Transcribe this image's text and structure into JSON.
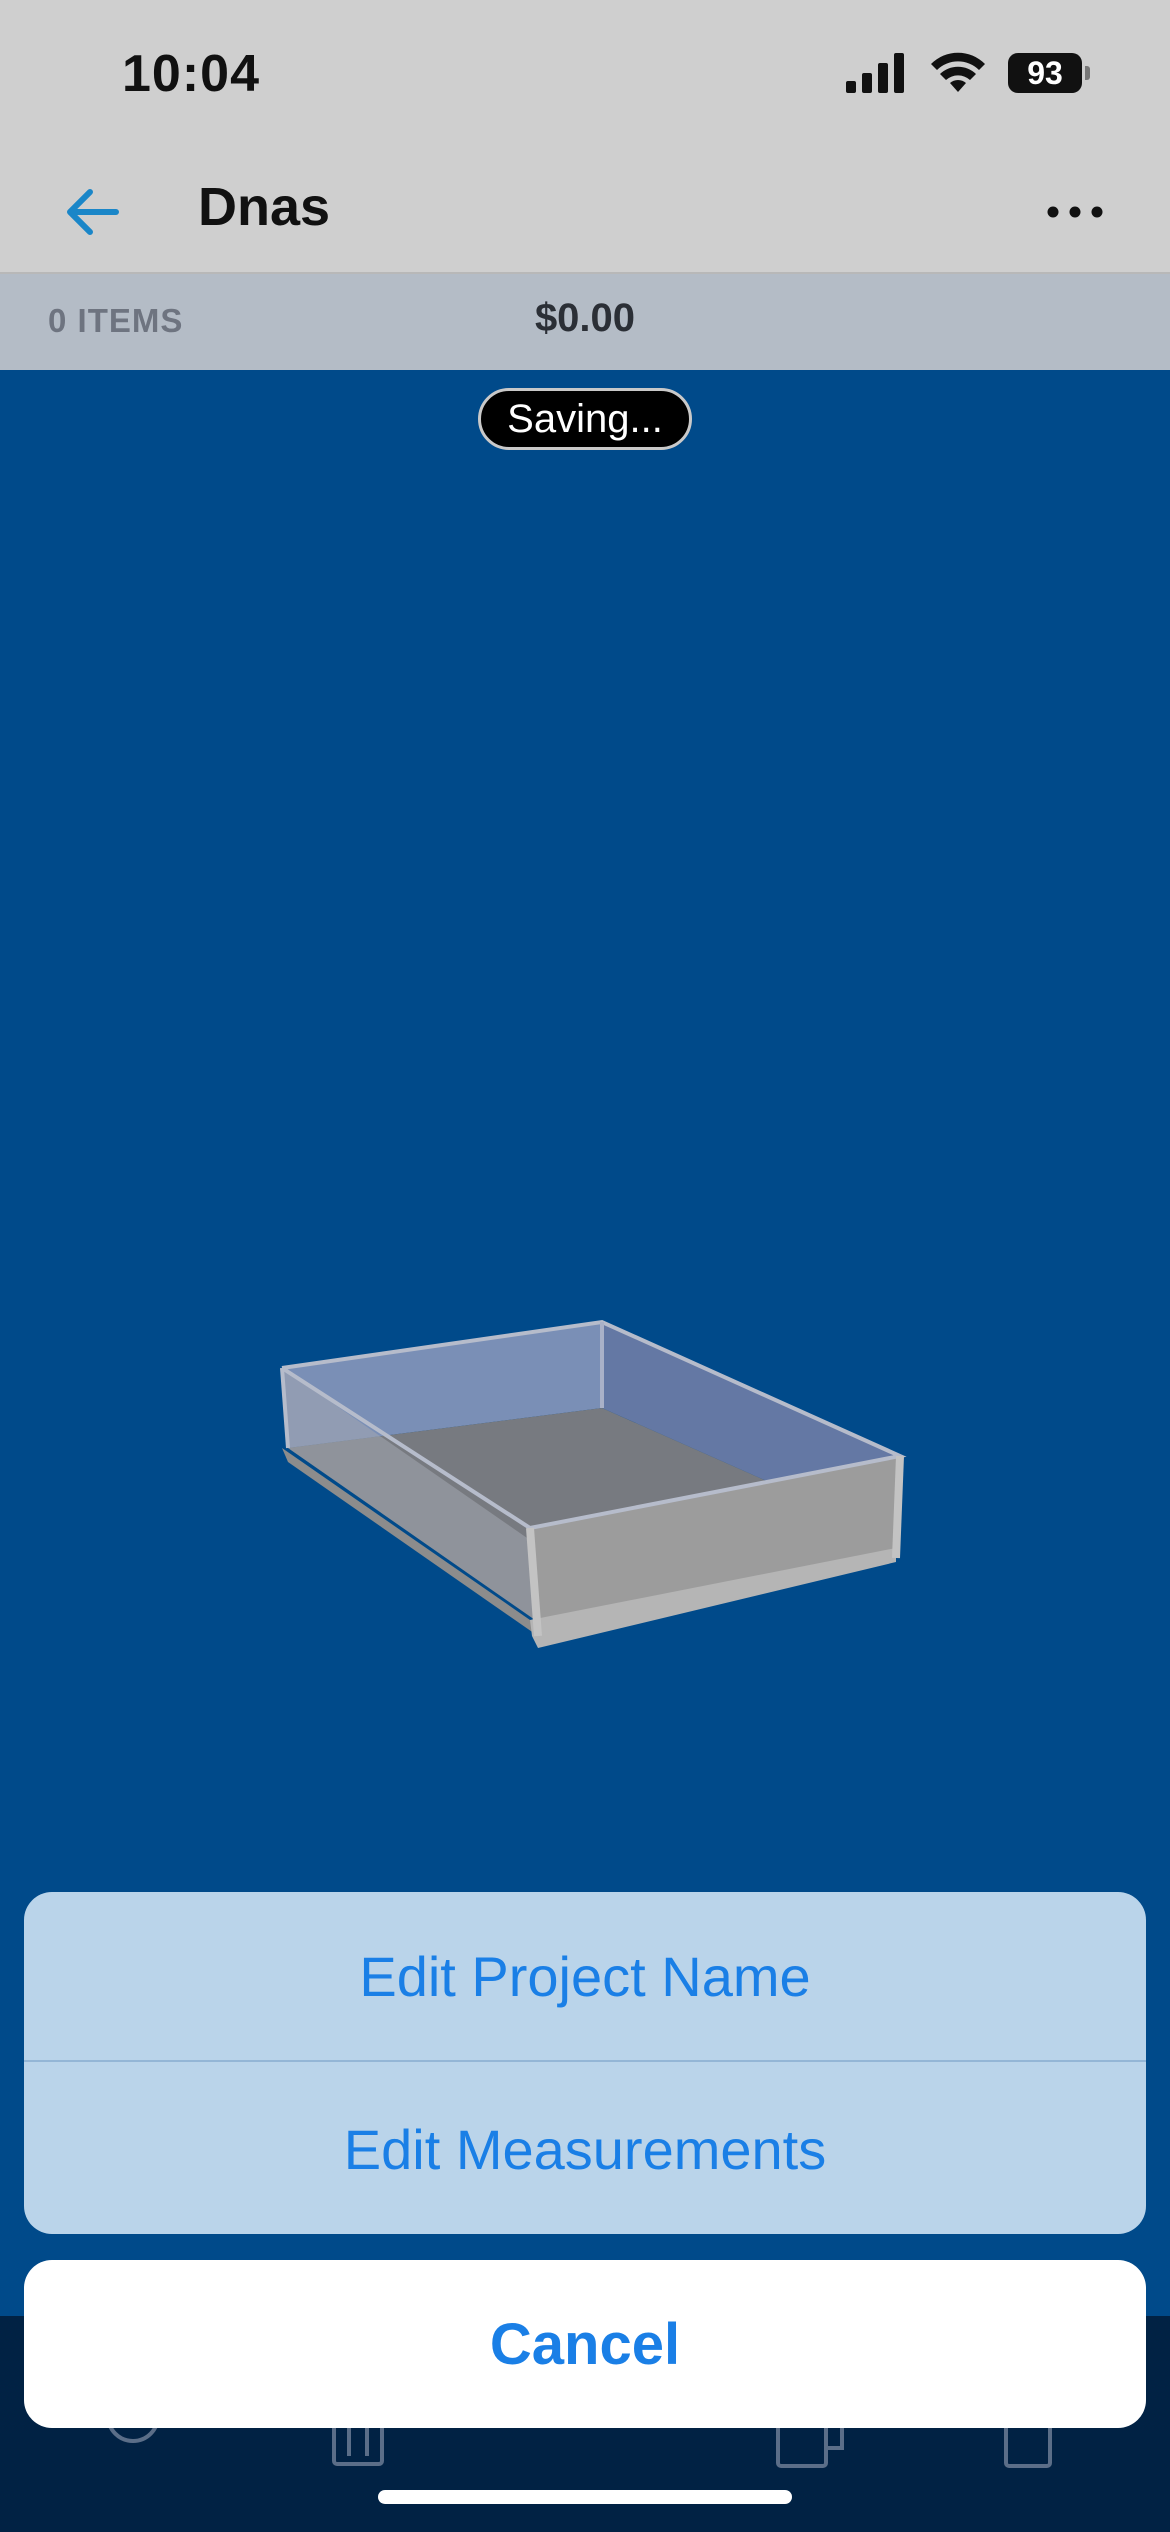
{
  "status_bar": {
    "time": "10:04",
    "battery_level": "93",
    "icons": [
      "cellular-signal-icon",
      "wifi-icon",
      "battery-icon"
    ]
  },
  "nav": {
    "title": "Dnas",
    "back_icon": "arrow-left-icon",
    "more_icon": "ellipsis-icon"
  },
  "summary": {
    "items_count": "0 ITEMS",
    "total": "$0.00"
  },
  "viewport": {
    "status": "Saving..."
  },
  "action_sheet": {
    "options": [
      {
        "label": "Edit Project Name"
      },
      {
        "label": "Edit Measurements"
      }
    ],
    "cancel_label": "Cancel"
  },
  "colors": {
    "accent": "#1a7fe6",
    "viewport_bg": "#004a8a",
    "header_bg": "#cfcfcf",
    "summary_bg": "#b4bcc6",
    "dock_bg": "#012244"
  }
}
